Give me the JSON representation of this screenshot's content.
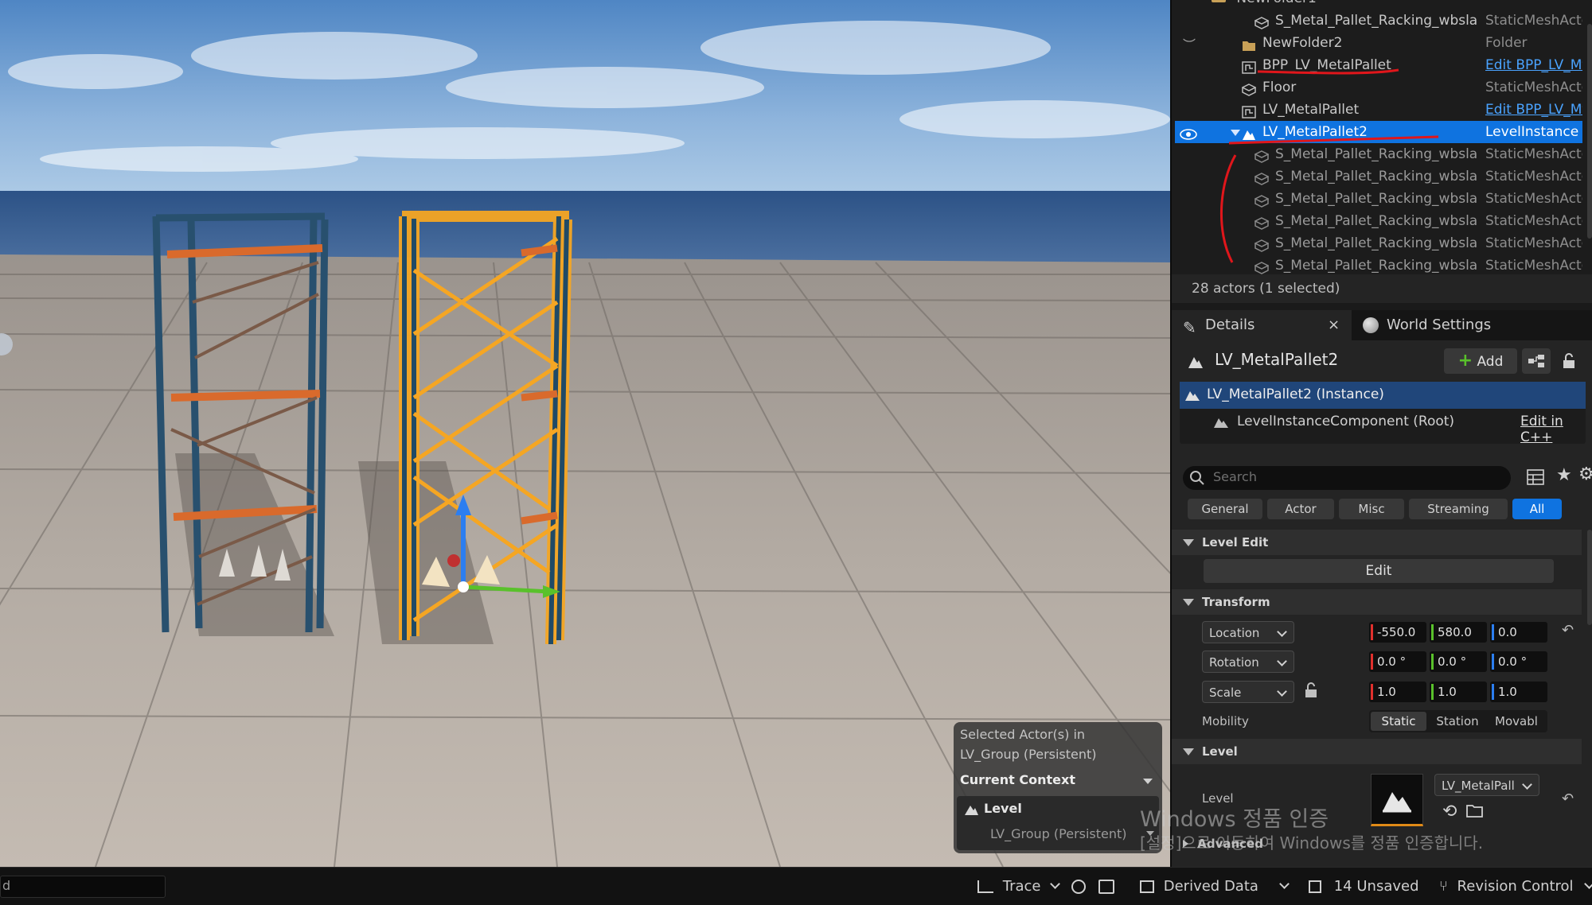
{
  "outliner": {
    "partial_top_label": "NewFolder1",
    "rows": [
      {
        "name": "S_Metal_Pallet_Racking_wbsla",
        "type": "StaticMeshActc"
      },
      {
        "name": "NewFolder2",
        "type": "Folder"
      },
      {
        "name": "BPP_LV_MetalPallet",
        "type": "Edit BPP_LV_Mt"
      },
      {
        "name": "Floor",
        "type": "StaticMeshActc"
      },
      {
        "name": "LV_MetalPallet",
        "type": "Edit BPP_LV_Mt"
      },
      {
        "name": "LV_MetalPallet2",
        "type": "LevelInstance"
      },
      {
        "name": "S_Metal_Pallet_Racking_wbsla",
        "type": "StaticMeshActc"
      },
      {
        "name": "S_Metal_Pallet_Racking_wbsla",
        "type": "StaticMeshActc"
      },
      {
        "name": "S_Metal_Pallet_Racking_wbsla",
        "type": "StaticMeshActc"
      },
      {
        "name": "S_Metal_Pallet_Racking_wbsla",
        "type": "StaticMeshActc"
      },
      {
        "name": "S_Metal_Pallet_Racking_wbsla",
        "type": "StaticMeshActc"
      },
      {
        "name": "S_Metal_Pallet_Racking_wbsla",
        "type": "StaticMeshActc"
      }
    ],
    "actor_count": "28 actors (1 selected)"
  },
  "details": {
    "tab_details": "Details",
    "tab_world_settings": "World Settings",
    "actor_name": "LV_MetalPallet2",
    "add_label": "Add",
    "instance_label": "LV_MetalPallet2 (Instance)",
    "component_label": "LevelInstanceComponent (Root)",
    "edit_cpp": "Edit in C++",
    "search_placeholder": "Search",
    "filters": [
      "General",
      "Actor",
      "Misc",
      "Streaming",
      "All"
    ],
    "level_edit": {
      "title": "Level Edit",
      "edit_button": "Edit"
    },
    "transform": {
      "title": "Transform",
      "location": {
        "label": "Location",
        "x": "-550.0",
        "y": "580.0",
        "z": "0.0"
      },
      "rotation": {
        "label": "Rotation",
        "x": "0.0 °",
        "y": "0.0 °",
        "z": "0.0 °"
      },
      "scale": {
        "label": "Scale",
        "x": "1.0",
        "y": "1.0",
        "z": "1.0"
      },
      "mobility": {
        "label": "Mobility",
        "options": [
          "Static",
          "Station",
          "Movabl"
        ]
      }
    },
    "level": {
      "title": "Level",
      "prop_label": "Level",
      "asset": "LV_MetalPall",
      "advanced": "Advanced"
    }
  },
  "context_popup": {
    "line1": "Selected Actor(s) in",
    "line2": "LV_Group (Persistent)",
    "header": "Current Context",
    "level": "Level",
    "persistent": "LV_Group (Persistent)"
  },
  "status_bar": {
    "console_fragment": "d",
    "trace": "Trace",
    "derived_data": "Derived Data",
    "unsaved": "14 Unsaved",
    "revision_control": "Revision Control"
  },
  "watermark": {
    "line1": "Windows 정품 인증",
    "line2": "[설정]으로 이동하여 Windows를 정품 인증합니다."
  },
  "colors": {
    "selection": "#0f73e0",
    "link": "#4aa3ff",
    "axis_x": "#e0302d",
    "axis_y": "#59c12b",
    "axis_z": "#2c7ef0",
    "selected_outline": "#f5a623",
    "annotation": "#e0161b"
  }
}
